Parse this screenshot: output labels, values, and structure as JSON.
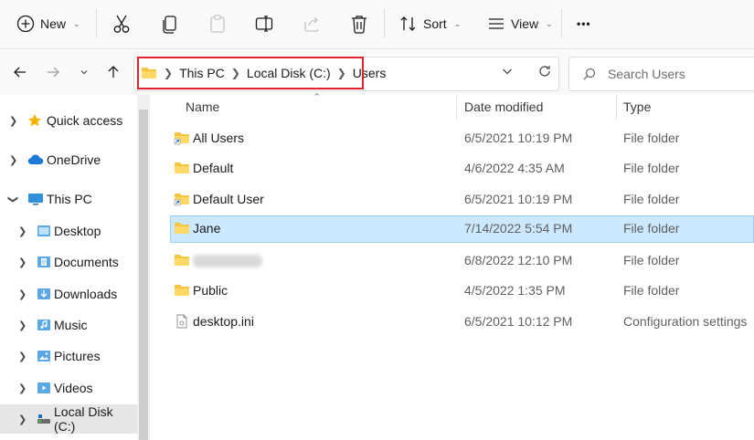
{
  "toolbar": {
    "new_label": "New",
    "sort_label": "Sort",
    "view_label": "View",
    "more_label": "•••"
  },
  "address": {
    "crumbs": [
      "This PC",
      "Local Disk (C:)",
      "Users"
    ]
  },
  "search": {
    "placeholder": "Search Users"
  },
  "sidebar": {
    "items": [
      {
        "label": "Quick access",
        "icon": "star-icon"
      },
      {
        "label": "OneDrive",
        "icon": "cloud-icon"
      },
      {
        "label": "This PC",
        "icon": "monitor-icon"
      },
      {
        "label": "Desktop",
        "icon": "desktop-folder-icon"
      },
      {
        "label": "Documents",
        "icon": "documents-folder-icon"
      },
      {
        "label": "Downloads",
        "icon": "downloads-folder-icon"
      },
      {
        "label": "Music",
        "icon": "music-folder-icon"
      },
      {
        "label": "Pictures",
        "icon": "pictures-folder-icon"
      },
      {
        "label": "Videos",
        "icon": "videos-folder-icon"
      },
      {
        "label": "Local Disk (C:)",
        "icon": "drive-icon"
      }
    ]
  },
  "columns": {
    "name": "Name",
    "date": "Date modified",
    "type": "Type"
  },
  "files": [
    {
      "name": "All Users",
      "date": "6/5/2021 10:19 PM",
      "type": "File folder",
      "icon": "folder-shortcut-icon"
    },
    {
      "name": "Default",
      "date": "4/6/2022 4:35 AM",
      "type": "File folder",
      "icon": "folder-icon"
    },
    {
      "name": "Default User",
      "date": "6/5/2021 10:19 PM",
      "type": "File folder",
      "icon": "folder-shortcut-icon"
    },
    {
      "name": "Jane",
      "date": "7/14/2022 5:54 PM",
      "type": "File folder",
      "icon": "folder-icon"
    },
    {
      "name": "",
      "date": "6/8/2022 12:10 PM",
      "type": "File folder",
      "icon": "folder-icon"
    },
    {
      "name": "Public",
      "date": "4/5/2022 1:35 PM",
      "type": "File folder",
      "icon": "folder-icon"
    },
    {
      "name": "desktop.ini",
      "date": "6/5/2021 10:12 PM",
      "type": "Configuration settings",
      "icon": "ini-file-icon"
    }
  ],
  "colors": {
    "accent": "#0067c0",
    "selection": "#cce8ff",
    "highlight_box": "#e0242d",
    "folder": "#f5c542"
  }
}
